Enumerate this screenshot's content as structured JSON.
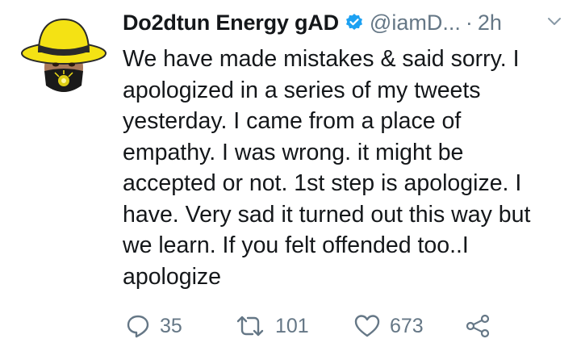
{
  "tweet": {
    "display_name": "Do2dtun Energy gAD",
    "handle": "@iamD...",
    "separator": "·",
    "time": "2h",
    "text": "We have made mistakes & said sorry. I\napologized in a series of my tweets\nyesterday. I came from a place of\nempathy. I was wrong. it might be\naccepted or not. 1st step is apologize. I\nhave. Very sad it turned out this way but\nwe learn. If you felt offended too..I\napologize",
    "counts": {
      "replies": "35",
      "retweets": "101",
      "likes": "673"
    }
  },
  "colors": {
    "text": "#14171a",
    "secondary": "#657786",
    "verified": "#1da1f2",
    "hat": "#f4e214"
  },
  "icons": [
    "verified-badge-icon",
    "caret-down-icon",
    "reply-icon",
    "retweet-icon",
    "like-icon",
    "share-icon"
  ]
}
